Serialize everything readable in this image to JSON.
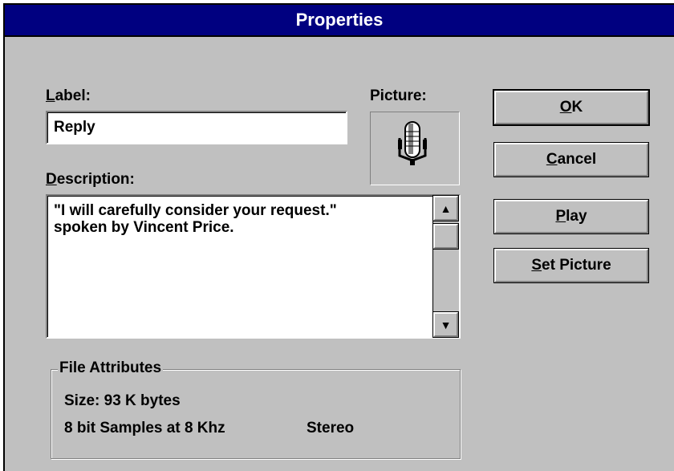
{
  "dialog": {
    "title": "Properties"
  },
  "label_field": {
    "accel": "L",
    "rest": "abel:",
    "value": "Reply"
  },
  "picture": {
    "label": "Picture:",
    "icon": "microphone-icon"
  },
  "description": {
    "accel": "D",
    "rest": "escription:",
    "text": "\"I will carefully consider your request.\"\nspoken by Vincent Price."
  },
  "file_attributes": {
    "title": "File Attributes",
    "size": "Size: 93 K bytes",
    "samples": "8 bit Samples at 8 Khz",
    "channels": "Stereo"
  },
  "buttons": {
    "ok": {
      "accel": "O",
      "rest": "K"
    },
    "cancel": {
      "accel": "C",
      "rest": "ancel"
    },
    "play": {
      "accel": "P",
      "rest": "lay"
    },
    "set_picture": {
      "accel": "S",
      "rest": "et Picture"
    }
  }
}
